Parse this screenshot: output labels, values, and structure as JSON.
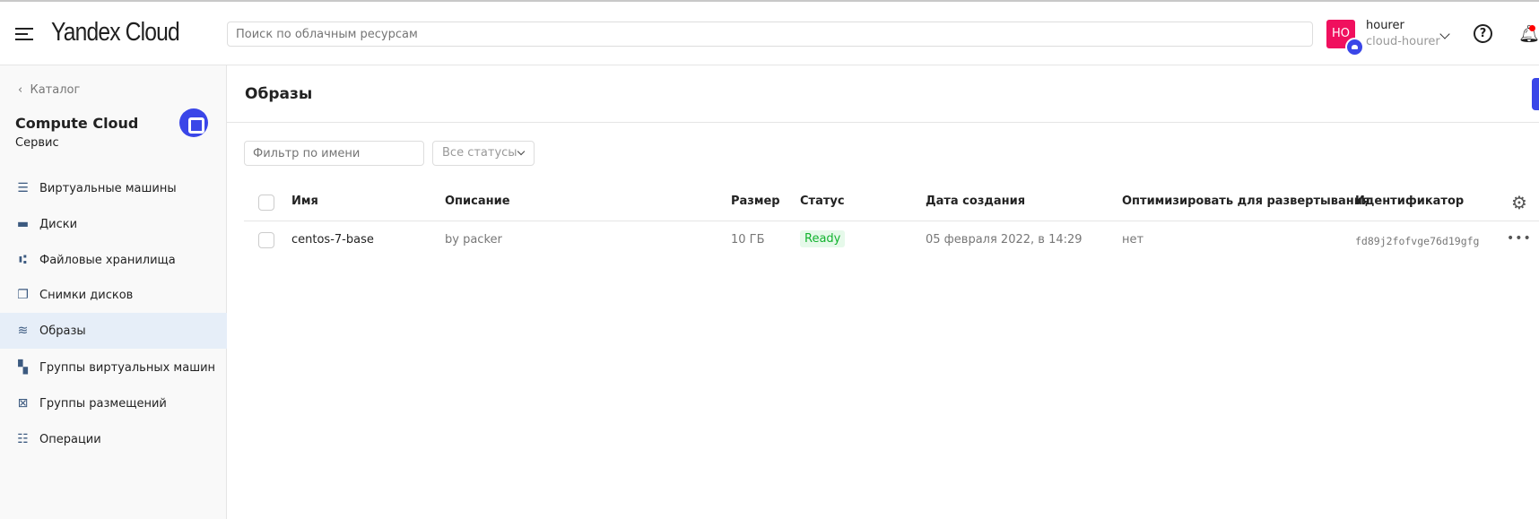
{
  "header": {
    "logo": "Yandex Cloud",
    "search_placeholder": "Поиск по облачным ресурсам",
    "user": {
      "initials": "HO",
      "name": "hourer",
      "cloud": "cloud-hourer"
    }
  },
  "sidebar": {
    "back": "Каталог",
    "service": "Compute Cloud",
    "service_sub": "Сервис",
    "items": [
      {
        "label": "Виртуальные машины",
        "icon": "server-icon"
      },
      {
        "label": "Диски",
        "icon": "disk-icon"
      },
      {
        "label": "Файловые хранилища",
        "icon": "file-storage-icon"
      },
      {
        "label": "Снимки дисков",
        "icon": "snapshot-icon"
      },
      {
        "label": "Образы",
        "icon": "layers-icon",
        "active": true
      },
      {
        "label": "Группы виртуальных машин",
        "icon": "instance-group-icon"
      },
      {
        "label": "Группы размещений",
        "icon": "placement-group-icon"
      },
      {
        "label": "Операции",
        "icon": "operations-icon"
      }
    ]
  },
  "main": {
    "title": "Образы",
    "filter_placeholder": "Фильтр по имени",
    "status_select": "Все статусы",
    "columns": [
      "Имя",
      "Описание",
      "Размер",
      "Статус",
      "Дата создания",
      "Оптимизировать для развертывания",
      "Идентификатор"
    ],
    "rows": [
      {
        "name": "centos-7-base",
        "description": "by packer",
        "size": "10 ГБ",
        "status": "Ready",
        "created": "05 февраля 2022, в 14:29",
        "optimize": "нет",
        "id": "fd89j2fofvge76d19gfg"
      }
    ]
  },
  "colors": {
    "accent": "#3a46e8",
    "avatar": "#f0105e",
    "ready": "#13b32f",
    "active_nav": "#e6eef8"
  }
}
